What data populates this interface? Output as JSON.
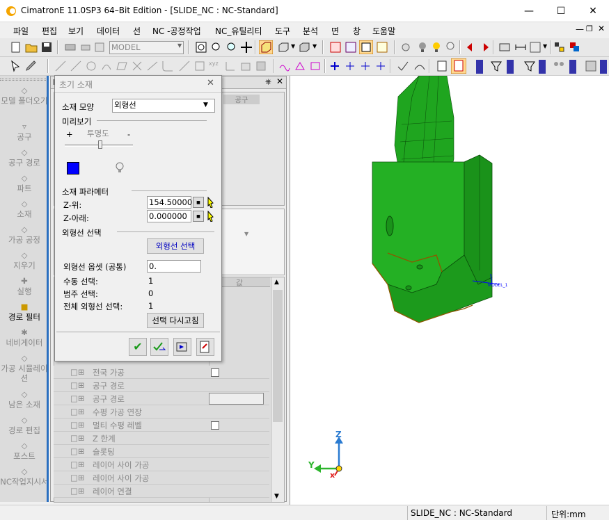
{
  "window": {
    "title": "CimatronE 11.0SP3 64–Bit Edition - [SLIDE_NC : NC-Standard]"
  },
  "menu": [
    "파일",
    "편집",
    "보기",
    "데이터",
    "선",
    "NC -공정작업",
    "NC_유틸리티",
    "도구",
    "분석",
    "면",
    "창",
    "도움말"
  ],
  "toolbar": {
    "model_combo": "MODEL"
  },
  "sidebar": {
    "items": [
      {
        "label": "모델 폴더오기"
      },
      {
        "label": "공구"
      },
      {
        "label": "공구 경로"
      },
      {
        "label": "파트"
      },
      {
        "label": "소재"
      },
      {
        "label": "가공 공정"
      },
      {
        "label": "지우기"
      },
      {
        "label": "실행"
      },
      {
        "label": "경로 필터"
      },
      {
        "label": "네비게이터"
      },
      {
        "label": "가공 시뮬레이션"
      },
      {
        "label": "남은 소재"
      },
      {
        "label": "경로 편집"
      },
      {
        "label": "포스트"
      },
      {
        "label": "NC작업지시서"
      }
    ]
  },
  "midpanel": {
    "header_left": "N",
    "header_tab": "공구",
    "value_header": "값",
    "rows": [
      "전국 가공",
      "공구 경로",
      "공구 경로",
      "수평 가공 연장",
      "멀티 수평 레벨",
      "Z 한계",
      "슬롯팅",
      "레이어 사이 가공",
      "레이어 사이 가공",
      "레이어 연결"
    ]
  },
  "dialog": {
    "title": "초기 소재",
    "shape_label": "소재 모양",
    "shape_value": "외형선",
    "preview_label": "미리보기",
    "plus": "+",
    "transparency": "투명도",
    "minus": "-",
    "params_label": "소재 파라메터",
    "z_top_label": "Z-위:",
    "z_top_value": "154.500000",
    "z_bottom_label": "Z-아래:",
    "z_bottom_value": "0.000000",
    "contour_select_label": "외형선 선택",
    "contour_select_button": "외형선 선택",
    "offset_label": "외형선 옵셋 (공통)",
    "offset_value": "0.",
    "manual_label": "수동 선택:",
    "manual_value": "1",
    "range_label": "범주 선택:",
    "range_value": "0",
    "total_label": "전체 외형선 선택:",
    "total_value": "1",
    "reselect_button": "선택 다시고침"
  },
  "viewport": {
    "model_label": "MODEL_1"
  },
  "statusbar": {
    "doc": "SLIDE_NC : NC-Standard",
    "units": "단위:mm"
  },
  "colors": {
    "part_green": "#1fa51f",
    "part_dark": "#0f7a0f",
    "edge_brown": "#8a5a00",
    "accent_blue": "#0000ff"
  }
}
